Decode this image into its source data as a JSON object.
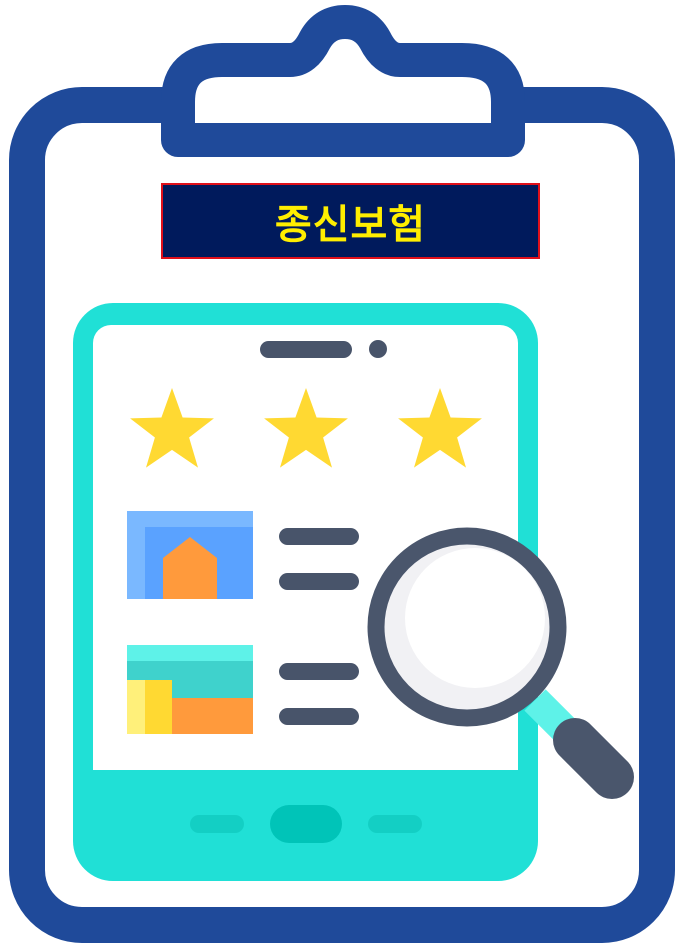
{
  "title": {
    "text": "종신보험"
  },
  "illustration": {
    "icons": [
      "clipboard-icon",
      "phone-icon",
      "star-icon",
      "image-thumbnail-icon",
      "magnifier-icon"
    ],
    "rating": {
      "value": 3,
      "max": 3
    },
    "colors": {
      "clipboard_outline": "#1f4a9a",
      "phone_frame": "#20e0d6",
      "phone_bottom_button": "#00c4b8",
      "speaker_bar": "#48546a",
      "star": "#ffd932",
      "thumb1_bg": "#5aa2ff",
      "house": "#ff9a3c",
      "thumb2_bg": "#3fd2cc",
      "magnifier_rim": "#4a566c",
      "magnifier_handle": "#4a566c",
      "magnifier_neck": "#5ef2e8",
      "title_bg": "#001a5c",
      "title_border": "#e0101a",
      "title_text": "#ffee00"
    }
  }
}
